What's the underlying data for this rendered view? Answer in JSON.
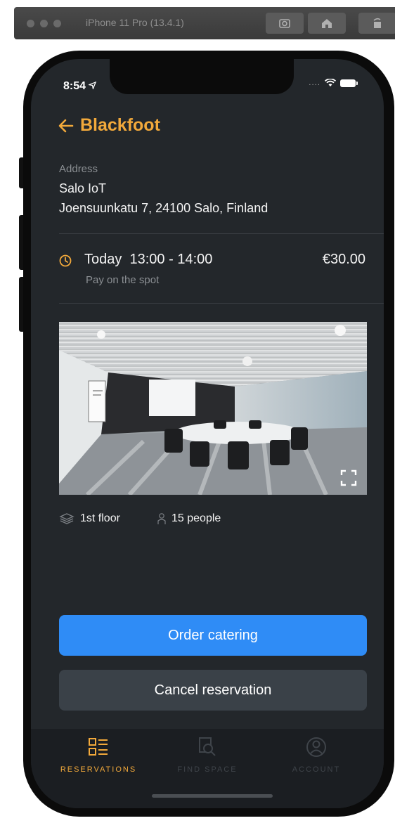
{
  "simulator": {
    "title": "iPhone 11 Pro (13.4.1)",
    "buttons": [
      "screenshot-icon",
      "home-icon",
      "rotate-icon"
    ]
  },
  "status_bar": {
    "time": "8:54",
    "signal": "....",
    "icons": [
      "location-arrow-icon",
      "wifi-icon",
      "battery-icon"
    ]
  },
  "header": {
    "back_icon": "arrow-left-icon",
    "title": "Blackfoot",
    "accent_color": "#f2a93b"
  },
  "address": {
    "label": "Address",
    "name": "Salo IoT",
    "street": "Joensuunkatu 7, 24100 Salo, Finland"
  },
  "booking": {
    "icon": "clock-icon",
    "day": "Today",
    "time_range": "13:00 - 14:00",
    "price": "€30.00",
    "payment_note": "Pay on the spot"
  },
  "space": {
    "floor": "1st floor",
    "capacity": "15 people",
    "floor_icon": "layers-icon",
    "capacity_icon": "person-icon",
    "expand_icon": "expand-icon"
  },
  "actions": {
    "order_catering": "Order catering",
    "cancel_reservation": "Cancel reservation",
    "primary_color": "#2f8cf6"
  },
  "tabbar": {
    "tabs": [
      {
        "label": "RESERVATIONS",
        "icon": "list-icon",
        "active": true
      },
      {
        "label": "FIND SPACE",
        "icon": "search-icon",
        "active": false
      },
      {
        "label": "ACCOUNT",
        "icon": "account-icon",
        "active": false
      }
    ]
  }
}
